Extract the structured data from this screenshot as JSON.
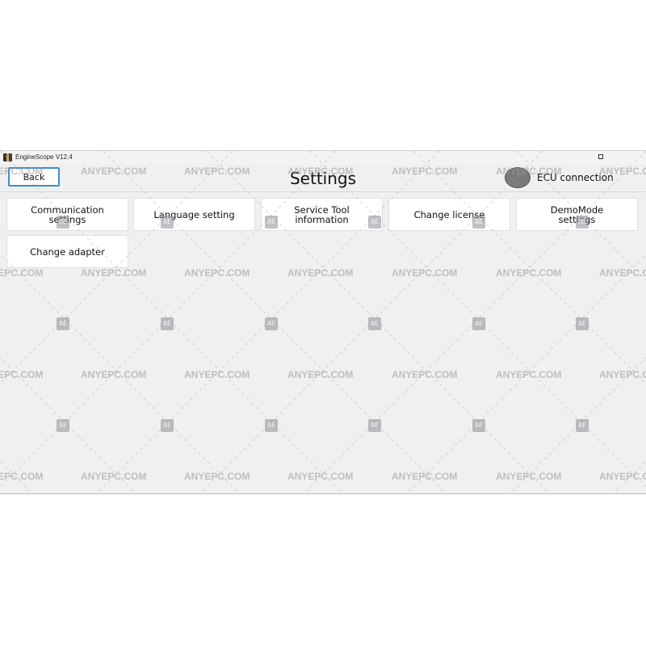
{
  "window": {
    "title": "EngineScope V12.4",
    "icon": "app-logo-icon",
    "maximize_icon": "maximize-icon"
  },
  "header": {
    "back_label": "Back",
    "title": "Settings",
    "ecu_label": "ECU connection",
    "ecu_status_color": "#7a7a7a"
  },
  "menu": [
    {
      "label": "Communication\nsettings"
    },
    {
      "label": "Language setting"
    },
    {
      "label": "Service Tool\ninformation"
    },
    {
      "label": "Change license"
    },
    {
      "label": "DemoMode\nsettings"
    },
    {
      "label": "Change adapter"
    }
  ],
  "watermark": {
    "text": "ANYEPC.COM",
    "badge": "AE"
  }
}
